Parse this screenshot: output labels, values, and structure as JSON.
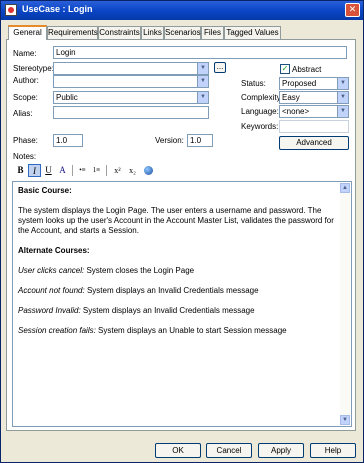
{
  "window": {
    "title": "UseCase : Login"
  },
  "tabs": [
    "General",
    "Requirements",
    "Constraints",
    "Links",
    "Scenarios",
    "Files",
    "Tagged Values"
  ],
  "form": {
    "name_label": "Name:",
    "name_value": "Login",
    "stereotype_label": "Stereotype:",
    "stereotype_value": "",
    "stereotype_button": "...",
    "abstract_label": "Abstract",
    "abstract_checked": "✓",
    "author_label": "Author:",
    "author_value": "",
    "status_label": "Status:",
    "status_value": "Proposed",
    "scope_label": "Scope:",
    "scope_value": "Public",
    "complexity_label": "Complexity:",
    "complexity_value": "Easy",
    "alias_label": "Alias:",
    "alias_value": "",
    "language_label": "Language:",
    "language_value": "<none>",
    "keywords_label": "Keywords:",
    "keywords_value": "",
    "advanced_button": "Advanced",
    "phase_label": "Phase:",
    "phase_value": "1.0",
    "version_label": "Version:",
    "version_value": "1.0",
    "notes_label": "Notes:"
  },
  "toolbar": {
    "bold": "B",
    "italic": "I",
    "underline": "U",
    "font_color": "A",
    "superscript": "x²",
    "subscript": "x₂"
  },
  "notes": {
    "heading1": "Basic Course:",
    "body": "The system displays the Login Page.  The user enters a username and password.  The system looks up the user's Account in the Account Master List, validates the password for the Account, and starts a Session.",
    "heading2": "Alternate Courses:",
    "alt1_name": "User clicks cancel:",
    "alt1_text": " System closes the Login Page",
    "alt2_name": "Account not found:",
    "alt2_text": " System displays an Invalid Credentials message",
    "alt3_name": "Password Invalid:",
    "alt3_text": " System displays an Invalid Credentials message",
    "alt4_name": "Session creation fails:",
    "alt4_text": "  System displays an Unable to start Session message"
  },
  "buttons": {
    "ok": "OK",
    "cancel": "Cancel",
    "apply": "Apply",
    "help": "Help"
  }
}
